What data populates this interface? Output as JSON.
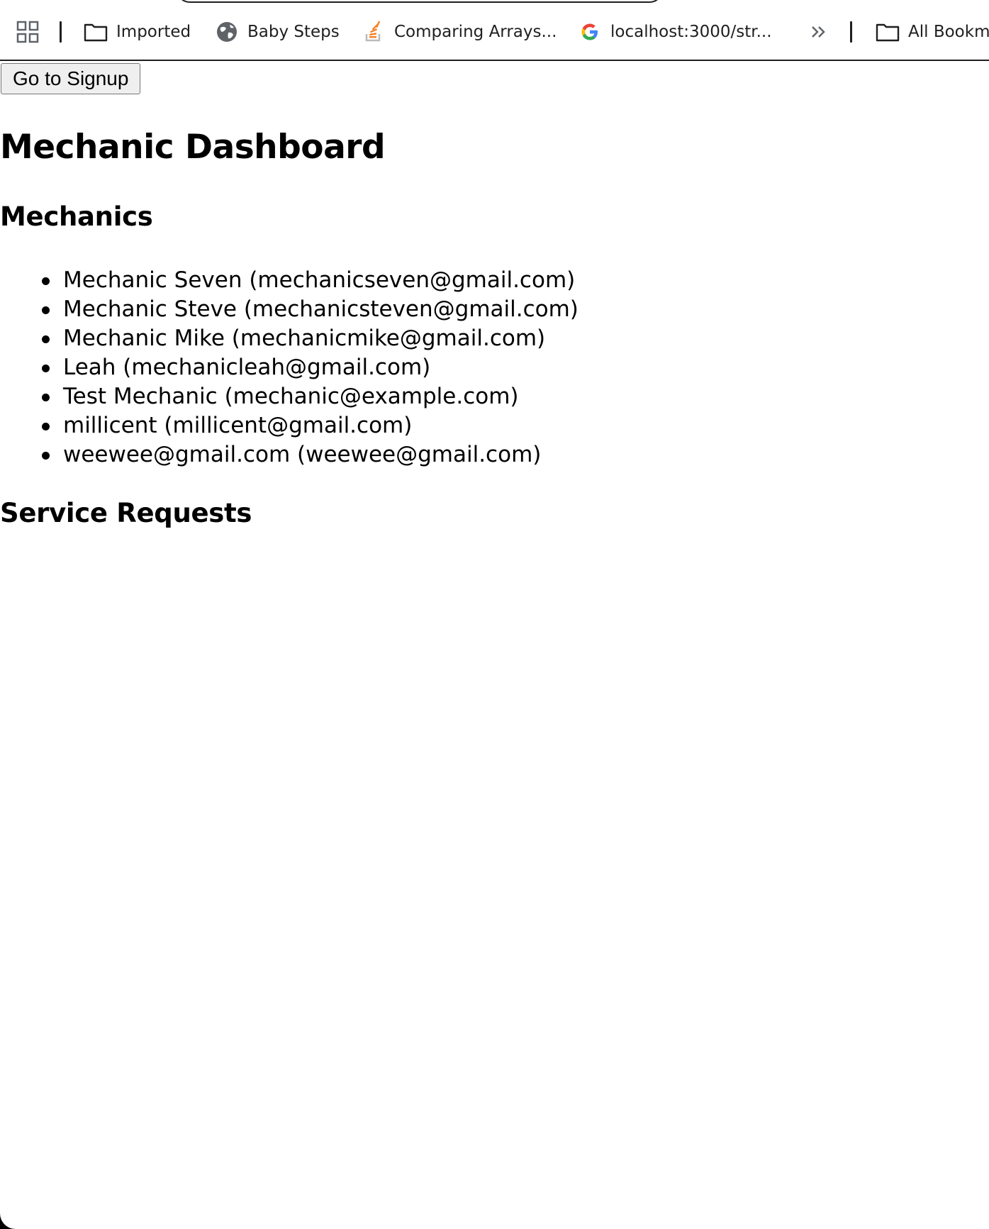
{
  "bookmarks": {
    "items": [
      {
        "label": "Imported",
        "icon": "folder-icon"
      },
      {
        "label": "Baby Steps",
        "icon": "globe-icon"
      },
      {
        "label": "Comparing Arrays...",
        "icon": "stackoverflow-icon"
      },
      {
        "label": "localhost:3000/str...",
        "icon": "google-icon"
      }
    ],
    "all_bookmarks_label": "All Bookm"
  },
  "page": {
    "signup_button_label": "Go to Signup",
    "title": "Mechanic Dashboard",
    "mechanics_heading": "Mechanics",
    "mechanics": [
      "Mechanic Seven (mechanicseven@gmail.com)",
      "Mechanic Steve (mechanicsteven@gmail.com)",
      "Mechanic Mike (mechanicmike@gmail.com)",
      "Leah (mechanicleah@gmail.com)",
      "Test Mechanic (mechanic@example.com)",
      "millicent (millicent@gmail.com)",
      "weewee@gmail.com (weewee@gmail.com)"
    ],
    "service_requests_heading": "Service Requests"
  },
  "colors": {
    "toolbar_text": "#1f1f1f",
    "stackoverflow_orange": "#f48024",
    "google_blue": "#4285f4",
    "google_red": "#ea4335",
    "google_yellow": "#fbbc05",
    "google_green": "#34a853",
    "globe_gray": "#5f6368"
  }
}
